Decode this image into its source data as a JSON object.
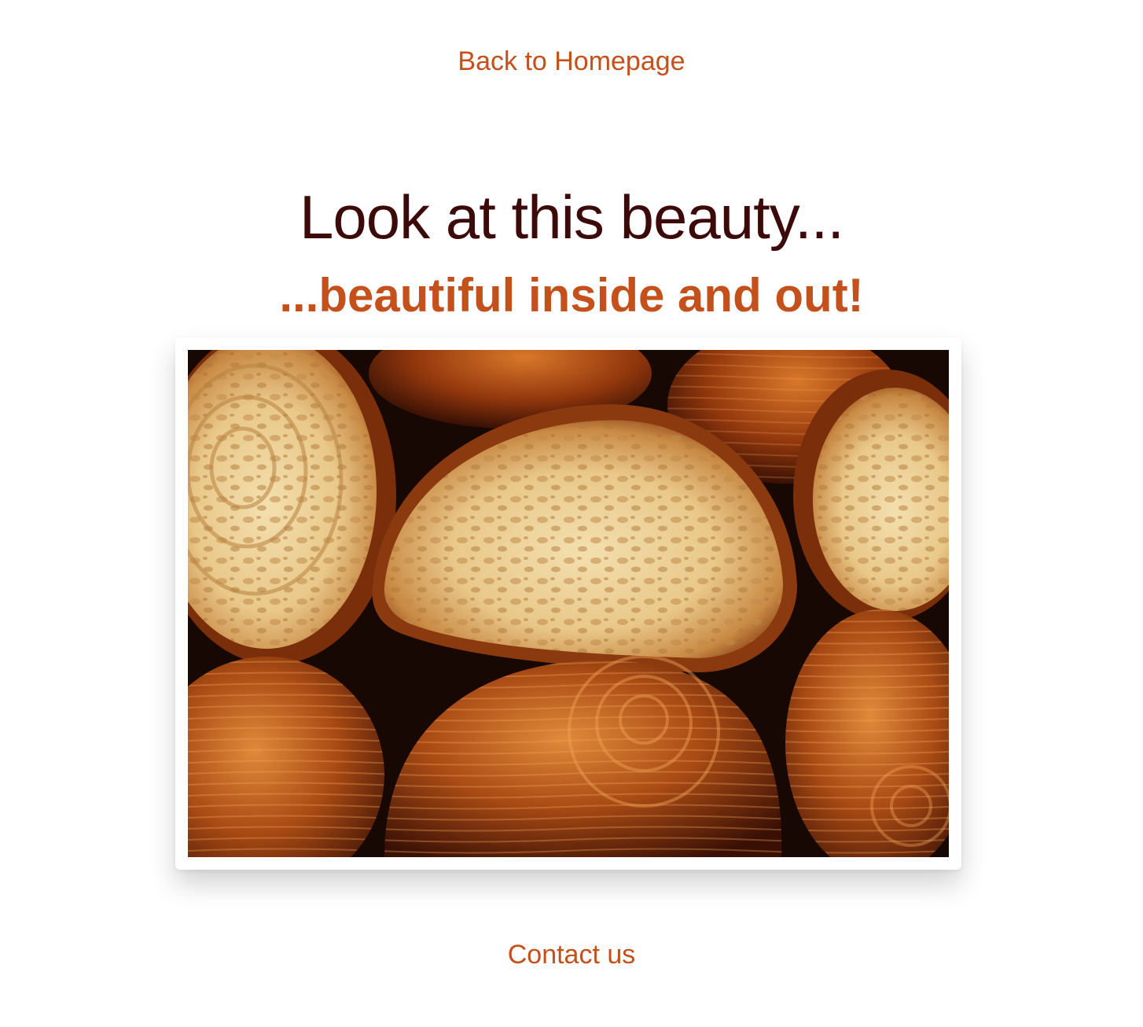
{
  "nav": {
    "back_label": "Back to Homepage"
  },
  "main": {
    "heading": "Look at this beauty...",
    "subheading": "...beautiful inside and out!",
    "image_alt": "Croissants"
  },
  "footer": {
    "contact_label": "Contact us"
  },
  "colors": {
    "accent": "#c4501c",
    "heading": "#3d0a0a",
    "background": "#ffffff"
  }
}
